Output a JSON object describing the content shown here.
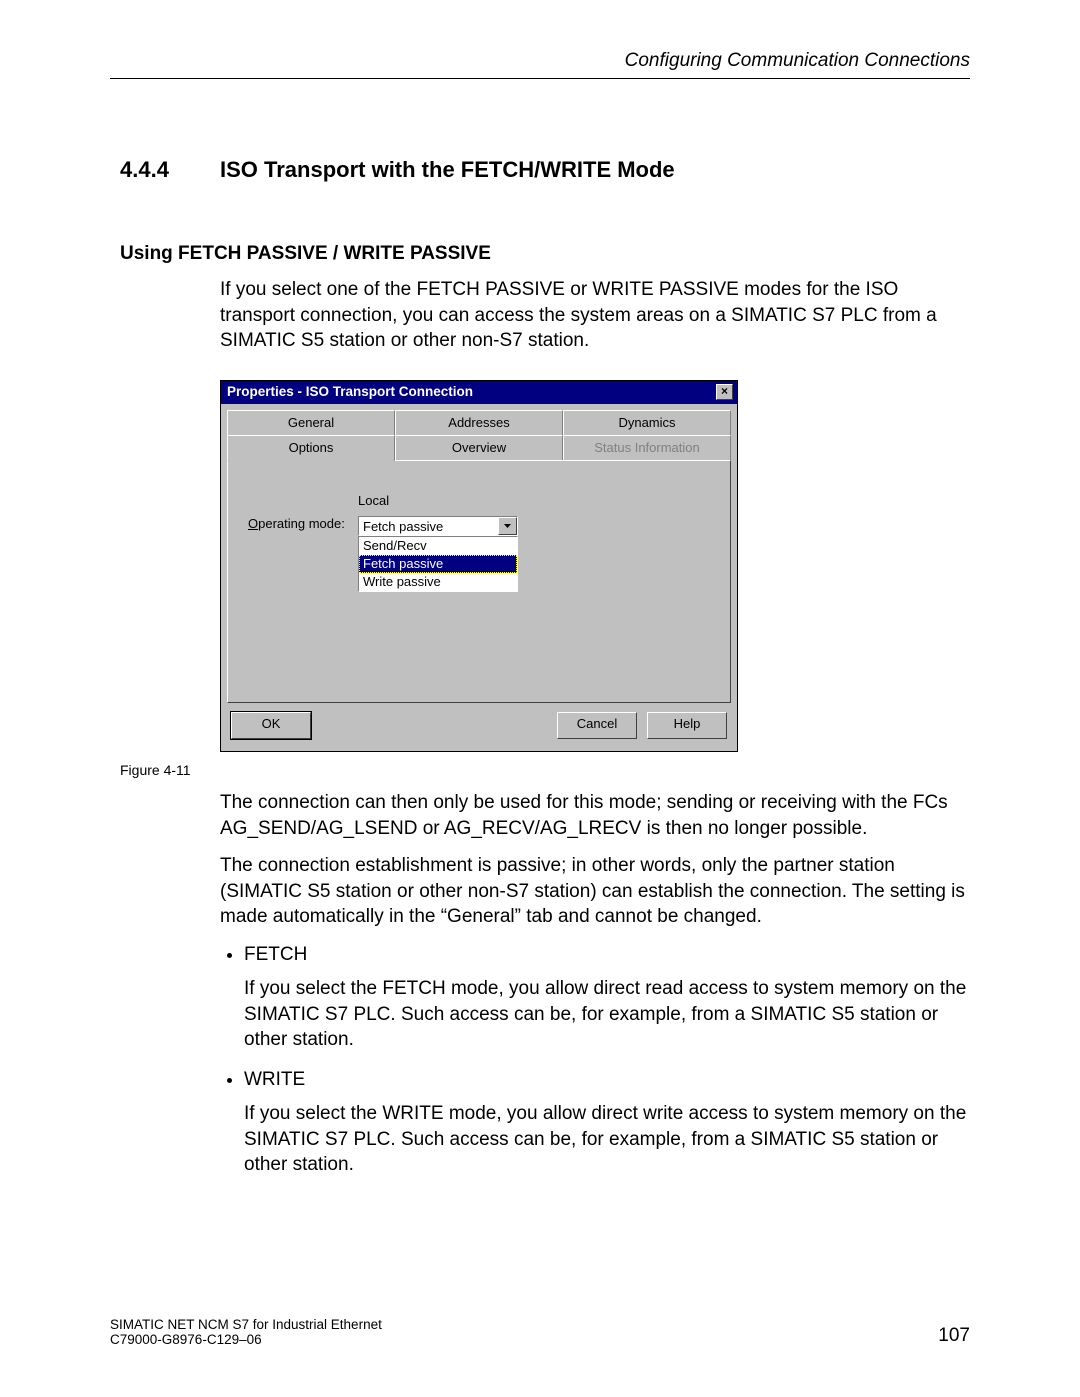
{
  "header": {
    "running": "Configuring Communication Connections"
  },
  "section": {
    "number": "4.4.4",
    "title": "ISO Transport with the FETCH/WRITE Mode"
  },
  "subsection": {
    "title": "Using FETCH PASSIVE / WRITE PASSIVE",
    "intro": "If you select one of the FETCH PASSIVE or WRITE PASSIVE modes for the ISO transport connection, you can access the system areas on a SIMATIC S7 PLC from a SIMATIC S5 station or other non-S7 station."
  },
  "dialog": {
    "title": "Properties - ISO Transport Connection",
    "close_glyph": "×",
    "tabs_back": [
      "General",
      "Addresses",
      "Dynamics"
    ],
    "tabs_front": [
      "Options",
      "Overview",
      "Status Information"
    ],
    "active_tab_index": 0,
    "disabled_front_index": 2,
    "column_header": "Local",
    "field_label_pre": "O",
    "field_label_post": "perating mode:",
    "combo_value": "Fetch passive",
    "options": [
      "Send/Recv",
      "Fetch passive",
      "Write passive"
    ],
    "selected_option_index": 1,
    "buttons": {
      "ok": "OK",
      "cancel": "Cancel",
      "help": "Help"
    }
  },
  "figure_caption": "Figure 4-11",
  "para_after1": "The connection can then only be used for this mode; sending or receiving with the FCs AG_SEND/AG_LSEND or AG_RECV/AG_LRECV is then no longer possible.",
  "para_after2": "The connection establishment is passive; in other words, only the partner station (SIMATIC S5 station or other non-S7 station) can establish the connection. The setting is made automatically in the “General” tab and cannot be changed.",
  "bullets": [
    {
      "label": "FETCH",
      "desc": "If you select the FETCH mode, you allow direct read access to system memory on the SIMATIC S7 PLC. Such access can be, for example, from a SIMATIC S5 station or other station."
    },
    {
      "label": "WRITE",
      "desc": "If you select the WRITE mode, you allow direct write access to system memory on the SIMATIC S7 PLC. Such access can be, for example, from a SIMATIC S5 station or other station."
    }
  ],
  "footer": {
    "line1": "SIMATIC NET NCM S7 for Industrial Ethernet",
    "line2": "C79000-G8976-C129–06",
    "page": "107"
  }
}
